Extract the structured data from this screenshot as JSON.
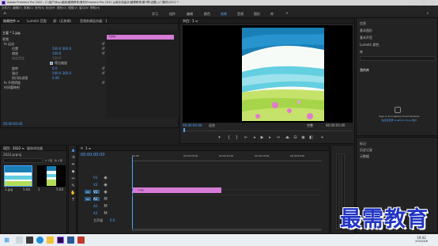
{
  "window": {
    "title": "Adobe Premiere Pro 2020 - C:\\用户\\Bay\\桌面\\最需教育\\素材\\Premiere Pro 2020 从新手到高手\\最需教育\\第3章\\设置\\入门素材\\2022 *"
  },
  "menu": [
    "文件(F)",
    "编辑(E)",
    "剪辑(C)",
    "序列(S)",
    "标记(M)",
    "图形(G)",
    "视图(V)",
    "窗口(W)",
    "帮助(H)"
  ],
  "workspaces": [
    "学习",
    "组件",
    "编辑",
    "颜色",
    "效果",
    "音频",
    "图形",
    "库"
  ],
  "effect_controls": {
    "tabs": [
      "效果控件 ≡",
      "Lumetri 范围",
      "源：(无剪辑)",
      "音频剪辑混合器：1"
    ],
    "clip_label": "主要 * 1.jpg",
    "clip_name": "1.jpg",
    "rows": [
      {
        "label": "视频",
        "value": ""
      },
      {
        "label": "fx 运动",
        "value": ""
      },
      {
        "label": "位置",
        "value": "540.0   360.0"
      },
      {
        "label": "缩放",
        "value": "100.0"
      },
      {
        "label": "缩放宽度",
        "value": "100.0"
      },
      {
        "label": "等比缩放",
        "value": ""
      },
      {
        "label": "旋转",
        "value": "0.0"
      },
      {
        "label": "锚点",
        "value": "540.0   360.0"
      },
      {
        "label": "防闪烁滤镜",
        "value": "0.00"
      },
      {
        "label": "fx 不透明度",
        "value": ""
      },
      {
        "label": "时间重映射",
        "value": ""
      }
    ],
    "timecode": "00:00:00:00"
  },
  "program_monitor": {
    "title": "节目：1 ≡",
    "timecode": "00:00:00:00",
    "fit": "适合",
    "quality": "完整",
    "duration": "00:00:05:00"
  },
  "right_panel": {
    "items": [
      "信息",
      "基本图形",
      "基本声音",
      "Lumetri 颜色",
      "库"
    ],
    "libraries_tab": "我的库",
    "library_message_line1": "Sign in to Creative Cloud Libraries",
    "library_message_line2": "在此处登录 Creative Cloud 帐户",
    "bottom_items": [
      "标记",
      "历史记录",
      "元数据"
    ]
  },
  "project_panel": {
    "tabs": [
      "项目：2022 ≡",
      "媒体浏览器"
    ],
    "file": "2022.prproj",
    "count": "1 个项，共 2 项",
    "items": [
      {
        "name": "1.jpg",
        "dur": "5:00"
      },
      {
        "name": "1",
        "dur": "5:00"
      }
    ]
  },
  "timeline": {
    "tab": "1 ≡",
    "timecode": "00:00:00:00",
    "ruler": [
      "00:00",
      "00:00:05:00",
      "00:00:10:00",
      "00:00:15:00",
      "00:00:20:00"
    ],
    "tracks": [
      "V3",
      "V2",
      "V1",
      "A1",
      "A2",
      "A3"
    ],
    "master_label": "主声道",
    "master_value": "0.0",
    "clip_label": "1.jpg"
  },
  "taskbar": {
    "time": "19:42",
    "date": "2022/4/6"
  },
  "watermark": "最需教育",
  "colors": {
    "accent": "#4fa3ff",
    "clip": "#d77ad6",
    "panel": "#232323"
  }
}
